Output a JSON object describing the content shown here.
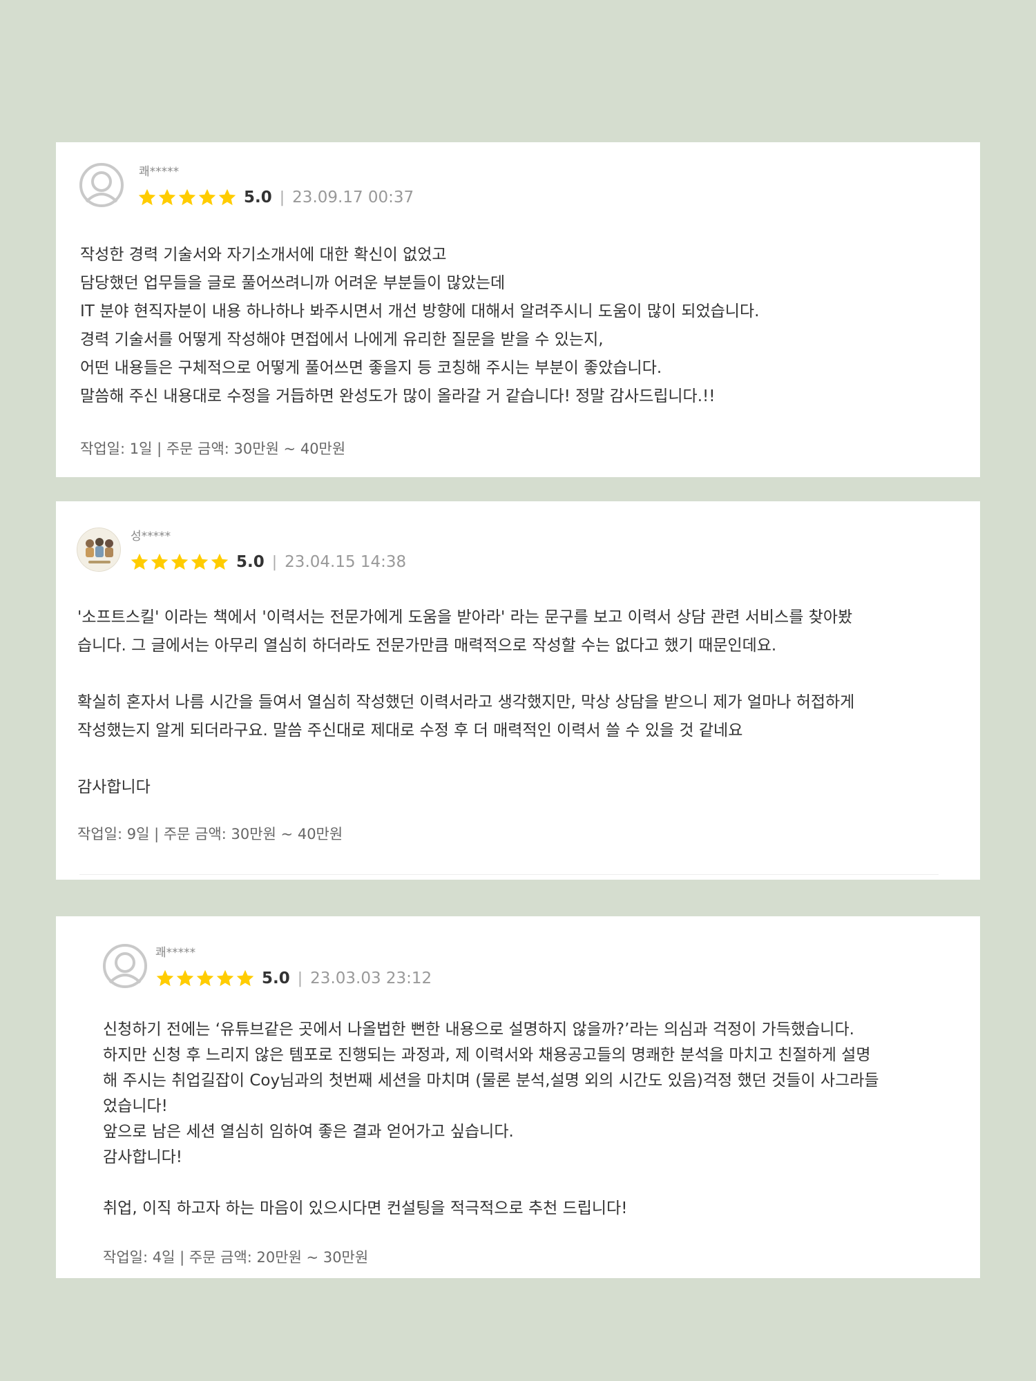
{
  "colors": {
    "page_background": "#d5ddcf",
    "card_background": "#ffffff",
    "star": "#ffcc00",
    "text": "#333333",
    "muted_text": "#999999"
  },
  "reviews": [
    {
      "avatar_icon": "default-user-avatar-icon",
      "nickname": "쾌*****",
      "stars": 5,
      "rating": "5.0",
      "separator": "|",
      "date": "23.09.17 00:37",
      "body_lines": [
        "작성한 경력 기술서와 자기소개서에 대한 확신이 없었고",
        "담당했던 업무들을 글로 풀어쓰려니까 어려운 부분들이 많았는데",
        "IT 분야 현직자분이 내용 하나하나 봐주시면서 개선 방향에 대해서 알려주시니 도움이 많이 되었습니다.",
        "경력 기술서를 어떻게 작성해야 면접에서 나에게 유리한 질문을 받을 수 있는지,",
        "어떤 내용들은 구체적으로 어떻게 풀어쓰면 좋을지 등 코칭해 주시는 부분이 좋았습니다.",
        "말씀해 주신 내용대로 수정을 거듭하면 완성도가 많이 올라갈 거 같습니다! 정말 감사드립니다.!!"
      ],
      "footer": "작업일: 1일 | 주문 금액: 30만원 ~ 40만원"
    },
    {
      "avatar_icon": "profile-photo-avatar-icon",
      "nickname": "성*****",
      "stars": 5,
      "rating": "5.0",
      "separator": "|",
      "date": "23.04.15 14:38",
      "body_lines": [
        "'소프트스킬' 이라는 책에서 '이력서는 전문가에게 도움을 받아라' 라는 문구를 보고 이력서 상담 관련 서비스를 찾아봤",
        "습니다. 그 글에서는 아무리 열심히 하더라도 전문가만큼 매력적으로 작성할 수는 없다고 했기 때문인데요.",
        "",
        "확실히 혼자서 나름 시간을 들여서 열심히 작성했던 이력서라고 생각했지만, 막상 상담을 받으니 제가 얼마나 허접하게",
        "작성했는지 알게 되더라구요. 말씀 주신대로 제대로 수정 후 더 매력적인 이력서 쓸 수 있을 것 같네요",
        "",
        "감사합니다"
      ],
      "footer": "작업일: 9일 | 주문 금액: 30만원 ~ 40만원"
    },
    {
      "avatar_icon": "default-user-avatar-icon",
      "nickname": "쾌*****",
      "stars": 5,
      "rating": "5.0",
      "separator": "|",
      "date": "23.03.03 23:12",
      "body_lines": [
        "신청하기 전에는 ‘유튜브같은 곳에서 나올법한  뻔한 내용으로 설명하지 않을까?’라는 의심과 걱정이 가득했습니다.",
        " 하지만 신청 후 느리지 않은 템포로 진행되는 과정과, 제 이력서와 채용공고들의 명쾌한 분석을 마치고 친절하게 설명",
        "해 주시는 취업길잡이 Coy님과의 첫번째 세션을 마치며 (물론 분석,설명 외의 시간도 있음)걱정 했던 것들이 사그라들",
        "었습니다!",
        "앞으로 남은 세션 열심히 임하여 좋은 결과 얻어가고 싶습니다.",
        "감사합니다!",
        "",
        "취업, 이직 하고자 하는 마음이 있으시다면 컨설팅을 적극적으로 추천 드립니다!"
      ],
      "footer": "작업일: 4일 | 주문 금액: 20만원 ~ 30만원"
    }
  ]
}
